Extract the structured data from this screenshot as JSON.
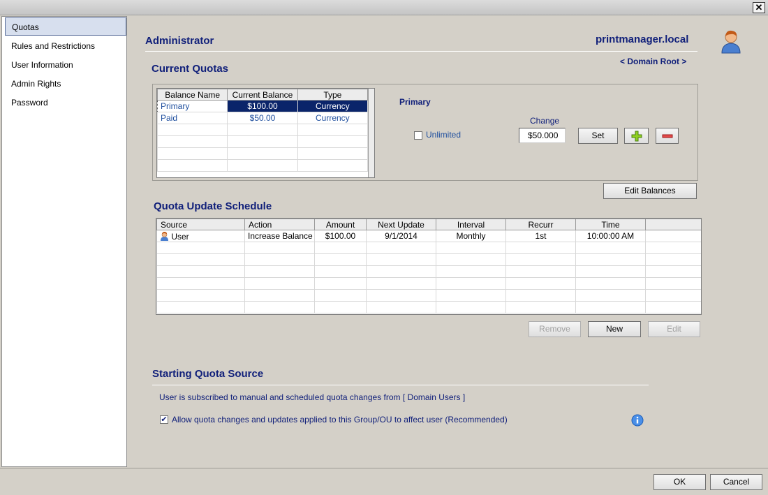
{
  "window": {
    "close_glyph": "✕"
  },
  "sidebar": {
    "items": [
      {
        "label": "Quotas"
      },
      {
        "label": "Rules and Restrictions"
      },
      {
        "label": "User Information"
      },
      {
        "label": "Admin Rights"
      },
      {
        "label": "Password"
      }
    ]
  },
  "header": {
    "user": "Administrator",
    "server": "printmanager.local",
    "domain_link": "< Domain Root >",
    "avatar_icon": "user-avatar-icon"
  },
  "current_quotas": {
    "title": "Current Quotas",
    "columns": [
      "Balance Name",
      "Current Balance",
      "Type"
    ],
    "rows": [
      {
        "name": "Primary",
        "balance": "$100.00",
        "type": "Currency"
      },
      {
        "name": "Paid",
        "balance": "$50.00",
        "type": "Currency"
      }
    ],
    "selected_label": "Primary",
    "unlimited_label": "Unlimited",
    "change_label": "Change",
    "change_value": "$50.000",
    "set_label": "Set",
    "add_icon": "plus-icon",
    "remove_icon": "minus-icon",
    "edit_balances_label": "Edit Balances"
  },
  "schedule": {
    "title": "Quota Update Schedule",
    "columns": [
      "Source",
      "Action",
      "Amount",
      "Next Update",
      "Interval",
      "Recurr",
      "Time"
    ],
    "rows": [
      {
        "source": "User",
        "action": "Increase Balance",
        "amount": "$100.00",
        "next_update": "9/1/2014",
        "interval": "Monthly",
        "recurr": "1st",
        "time": "10:00:00 AM"
      }
    ],
    "remove_label": "Remove",
    "new_label": "New",
    "edit_label": "Edit"
  },
  "starting_source": {
    "title": "Starting Quota Source",
    "subscribed_text": "User is subscribed to manual and scheduled quota changes from [ Domain Users ]",
    "allow_label": "Allow quota changes and updates applied to this Group/OU to affect user (Recommended)",
    "allow_checked": true,
    "info_icon": "info-icon"
  },
  "footer": {
    "ok_label": "OK",
    "cancel_label": "Cancel"
  },
  "colors": {
    "navy": "#11207a",
    "selection": "#0a246a",
    "link": "#1f4f9e"
  }
}
